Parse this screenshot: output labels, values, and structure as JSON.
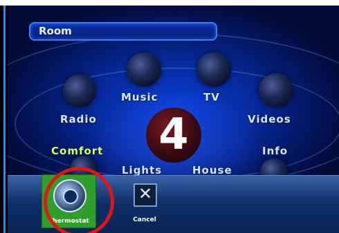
{
  "room_field": {
    "value": "Room"
  },
  "menu": {
    "radio": "Radio",
    "music": "Music",
    "tv": "TV",
    "videos": "Videos",
    "comfort": "Comfort",
    "info": "Info",
    "lights": "Lights",
    "house": "House",
    "center_glyph": "4"
  },
  "bottom_bar": {
    "thermostat_label": "Thermostat",
    "cancel_label": "Cancel"
  },
  "colors": {
    "accent_blue": "#1f8fff",
    "highlight_red": "#e01515",
    "selected_green": "#2f9f2a"
  },
  "icons": [
    "radio-icon",
    "music-icon",
    "tv-icon",
    "videos-icon",
    "thermostat-icon",
    "cancel-icon",
    "info-icon"
  ]
}
